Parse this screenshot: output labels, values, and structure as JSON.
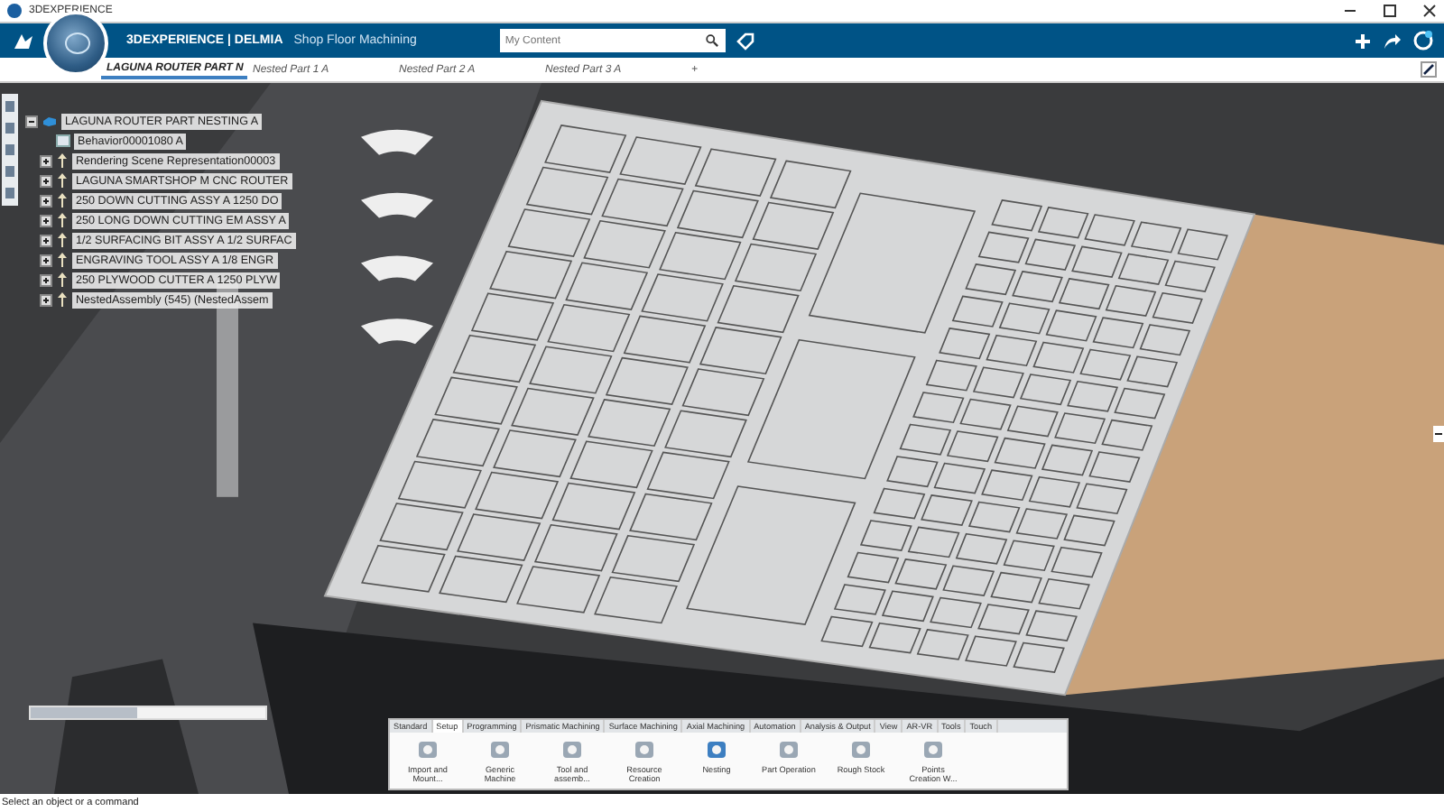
{
  "window": {
    "title": "3DEXPERIENCE"
  },
  "app_bar": {
    "brand": "3DEXPERIENCE | DELMIA",
    "app_name": "Shop Floor Machining",
    "search": {
      "placeholder": "My Content"
    }
  },
  "tabs": [
    {
      "label": "LAGUNA ROUTER PART N",
      "selected": true
    },
    {
      "label": "Nested Part 1 A",
      "selected": false
    },
    {
      "label": "Nested Part 2 A",
      "selected": false
    },
    {
      "label": "Nested Part 3 A",
      "selected": false
    },
    {
      "label": "+",
      "selected": false
    }
  ],
  "tree": {
    "label": "LAGUNA ROUTER PART NESTING A",
    "expanded": true,
    "children": [
      {
        "label": "Behavior00001080 A",
        "kind": "leaf"
      },
      {
        "label": "Rendering Scene Representation00003",
        "expanded": false,
        "kind": "node"
      },
      {
        "label": "LAGUNA SMARTSHOP M CNC ROUTER",
        "expanded": false,
        "kind": "node"
      },
      {
        "label": "250 DOWN CUTTING ASSY A 1250 DO",
        "expanded": false,
        "kind": "node"
      },
      {
        "label": "250 LONG DOWN CUTTING EM ASSY A",
        "expanded": false,
        "kind": "node"
      },
      {
        "label": "1/2 SURFACING BIT ASSY A 1/2 SURFAC",
        "expanded": false,
        "kind": "node"
      },
      {
        "label": "ENGRAVING TOOL ASSY A 1/8 ENGR",
        "expanded": false,
        "kind": "node"
      },
      {
        "label": "250 PLYWOOD CUTTER A 1250 PLYW",
        "expanded": false,
        "kind": "node"
      },
      {
        "label": "NestedAssembly (545) (NestedAssem",
        "expanded": false,
        "kind": "node"
      }
    ]
  },
  "ribbon": {
    "tabs": [
      {
        "label": "Standard",
        "selected": false
      },
      {
        "label": "Setup",
        "selected": true
      },
      {
        "label": "Programming",
        "selected": false
      },
      {
        "label": "Prismatic Machining",
        "selected": false
      },
      {
        "label": "Surface Machining",
        "selected": false
      },
      {
        "label": "Axial Machining",
        "selected": false
      },
      {
        "label": "Automation",
        "selected": false
      },
      {
        "label": "Analysis & Output",
        "selected": false
      },
      {
        "label": "View",
        "selected": false
      },
      {
        "label": "AR-VR",
        "selected": false
      },
      {
        "label": "Tools",
        "selected": false
      },
      {
        "label": "Touch",
        "selected": false
      }
    ],
    "commands": [
      "Import and Mount...",
      "Generic Machine",
      "Tool and assemb...",
      "Resource Creation",
      "Nesting",
      "Part Operation",
      "Rough Stock",
      "Points Creation W..."
    ]
  },
  "status_bar": {
    "text": "Select an object or a command"
  }
}
